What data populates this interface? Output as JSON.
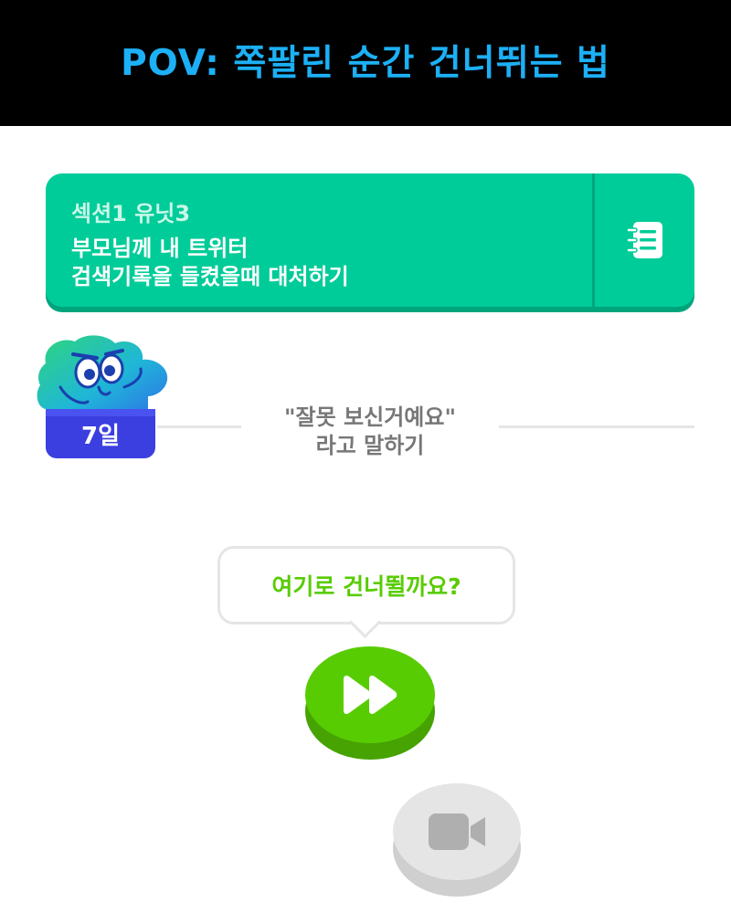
{
  "meme": {
    "title": "POV: 쪽팔린 순간 건너뛰는 법"
  },
  "unit": {
    "section_label": "섹션1 유닛3",
    "description_line1": "부모님께 내 트위터",
    "description_line2": "검색기록을 들켰을때 대처하기",
    "guidebook_icon": "guidebook-icon"
  },
  "streak": {
    "badge_label": "7일",
    "character_icon": "duo-character-icon"
  },
  "lesson_divider": {
    "line1": "\"잘못 보신거예요\"",
    "line2": "라고 말하기"
  },
  "jump": {
    "bubble_text": "여기로 건너뛸까요?",
    "button_icon": "fast-forward-icon"
  },
  "next_node": {
    "icon": "video-camera-icon"
  },
  "colors": {
    "title_blue": "#1CB0F6",
    "unit_green": "#00CC99",
    "unit_green_shadow": "#00A47C",
    "skip_green": "#58CC02",
    "skip_green_shadow": "#46A302",
    "streak_blue": "#3B3FE0",
    "locked_gray": "#E5E5E5",
    "locked_icon_gray": "#AFAFAF",
    "divider_text_gray": "#777777"
  }
}
